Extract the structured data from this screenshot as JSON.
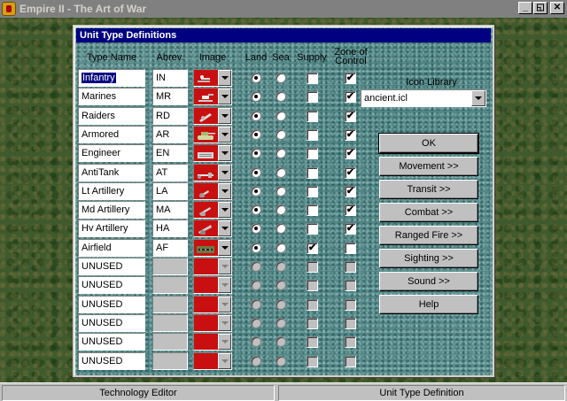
{
  "app": {
    "title": "Empire II - The Art of War",
    "controls": [
      "_",
      "◱",
      "✕"
    ]
  },
  "dialog": {
    "title": "Unit Type Definitions",
    "headers": {
      "type_name": "Type Name",
      "abbrev": "Abrev.",
      "image": "Image",
      "land": "Land",
      "sea": "Sea",
      "supply": "Supply",
      "zoc": "Zone of Control"
    },
    "rows": [
      {
        "name": "Infantry",
        "abbr": "IN",
        "icon": "infantry-icon",
        "land": true,
        "sea": false,
        "supply": false,
        "zoc": true,
        "enabled": true
      },
      {
        "name": "Marines",
        "abbr": "MR",
        "icon": "marines-icon",
        "land": true,
        "sea": false,
        "supply": false,
        "zoc": true,
        "enabled": true
      },
      {
        "name": "Raiders",
        "abbr": "RD",
        "icon": "raiders-icon",
        "land": true,
        "sea": false,
        "supply": false,
        "zoc": true,
        "enabled": true
      },
      {
        "name": "Armored",
        "abbr": "AR",
        "icon": "tank-icon",
        "land": true,
        "sea": false,
        "supply": false,
        "zoc": true,
        "enabled": true
      },
      {
        "name": "Engineer",
        "abbr": "EN",
        "icon": "engineer-icon",
        "land": true,
        "sea": false,
        "supply": false,
        "zoc": true,
        "enabled": true
      },
      {
        "name": "AntiTank",
        "abbr": "AT",
        "icon": "antitank-icon",
        "land": true,
        "sea": false,
        "supply": false,
        "zoc": true,
        "enabled": true
      },
      {
        "name": "Lt Artillery",
        "abbr": "LA",
        "icon": "light-artillery-icon",
        "land": true,
        "sea": false,
        "supply": false,
        "zoc": true,
        "enabled": true
      },
      {
        "name": "Md Artillery",
        "abbr": "MA",
        "icon": "medium-artillery-icon",
        "land": true,
        "sea": false,
        "supply": false,
        "zoc": true,
        "enabled": true
      },
      {
        "name": "Hv Artillery",
        "abbr": "HA",
        "icon": "heavy-artillery-icon",
        "land": true,
        "sea": false,
        "supply": false,
        "zoc": true,
        "enabled": true
      },
      {
        "name": "Airfield",
        "abbr": "AF",
        "icon": "airfield-icon",
        "land": true,
        "sea": false,
        "supply": true,
        "zoc": false,
        "enabled": true
      },
      {
        "name": "UNUSED",
        "abbr": "",
        "icon": "",
        "land": false,
        "sea": false,
        "supply": false,
        "zoc": false,
        "enabled": false
      },
      {
        "name": "UNUSED",
        "abbr": "",
        "icon": "",
        "land": false,
        "sea": false,
        "supply": false,
        "zoc": false,
        "enabled": false
      },
      {
        "name": "UNUSED",
        "abbr": "",
        "icon": "",
        "land": false,
        "sea": false,
        "supply": false,
        "zoc": false,
        "enabled": false
      },
      {
        "name": "UNUSED",
        "abbr": "",
        "icon": "",
        "land": false,
        "sea": false,
        "supply": false,
        "zoc": false,
        "enabled": false
      },
      {
        "name": "UNUSED",
        "abbr": "",
        "icon": "",
        "land": false,
        "sea": false,
        "supply": false,
        "zoc": false,
        "enabled": false
      },
      {
        "name": "UNUSED",
        "abbr": "",
        "icon": "",
        "land": false,
        "sea": false,
        "supply": false,
        "zoc": false,
        "enabled": false
      }
    ],
    "icon_library": {
      "label": "Icon Library",
      "value": "ancient.icl"
    },
    "buttons": [
      {
        "name": "ok-button",
        "label": "OK"
      },
      {
        "name": "movement-button",
        "label": "Movement  >>"
      },
      {
        "name": "transit-button",
        "label": "Transit  >>"
      },
      {
        "name": "combat-button",
        "label": "Combat  >>"
      },
      {
        "name": "ranged-fire-button",
        "label": "Ranged Fire  >>"
      },
      {
        "name": "sighting-button",
        "label": "Sighting  >>"
      },
      {
        "name": "sound-button",
        "label": "Sound  >>"
      },
      {
        "name": "help-button",
        "label": "Help"
      }
    ]
  },
  "status_bar": {
    "left": "Technology Editor",
    "right": "Unit Type Definition"
  },
  "colors": {
    "title_bar": "#000080",
    "image_box": "#c81010",
    "dialog_bg": "#4e8484"
  }
}
